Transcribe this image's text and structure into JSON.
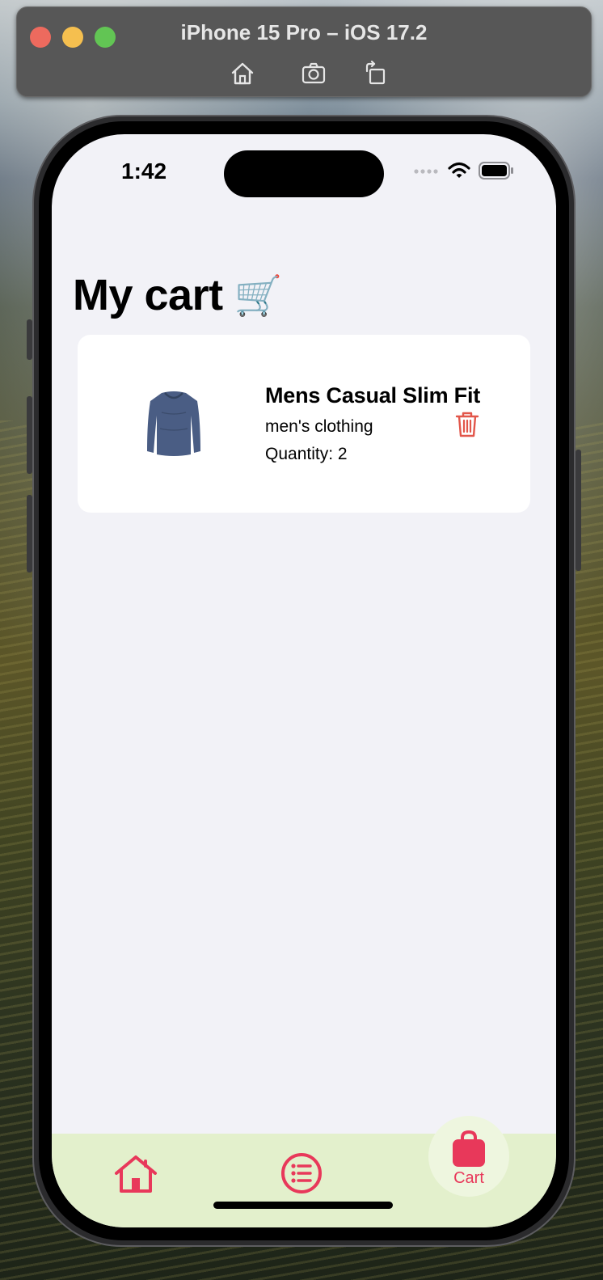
{
  "simulator": {
    "title": "iPhone 15 Pro – iOS 17.2",
    "buttons": [
      "home",
      "screenshot",
      "rotate"
    ]
  },
  "status_bar": {
    "time": "1:42"
  },
  "page": {
    "title": "My cart",
    "title_emoji": "🛒"
  },
  "cart": {
    "items": [
      {
        "name": "Mens Casual Slim Fit",
        "category": "men's clothing",
        "quantity_label": "Quantity: 2"
      }
    ]
  },
  "tab_bar": {
    "tabs": [
      {
        "icon": "house-icon"
      },
      {
        "icon": "list-icon"
      },
      {
        "icon": "bag-icon",
        "label": "Cart"
      }
    ],
    "active_tab": "Cart"
  },
  "colors": {
    "accent": "#e8385a",
    "tabbar_bg": "#e3f0cc",
    "screen_bg": "#f2f2f7",
    "delete_red": "#e2564a"
  }
}
